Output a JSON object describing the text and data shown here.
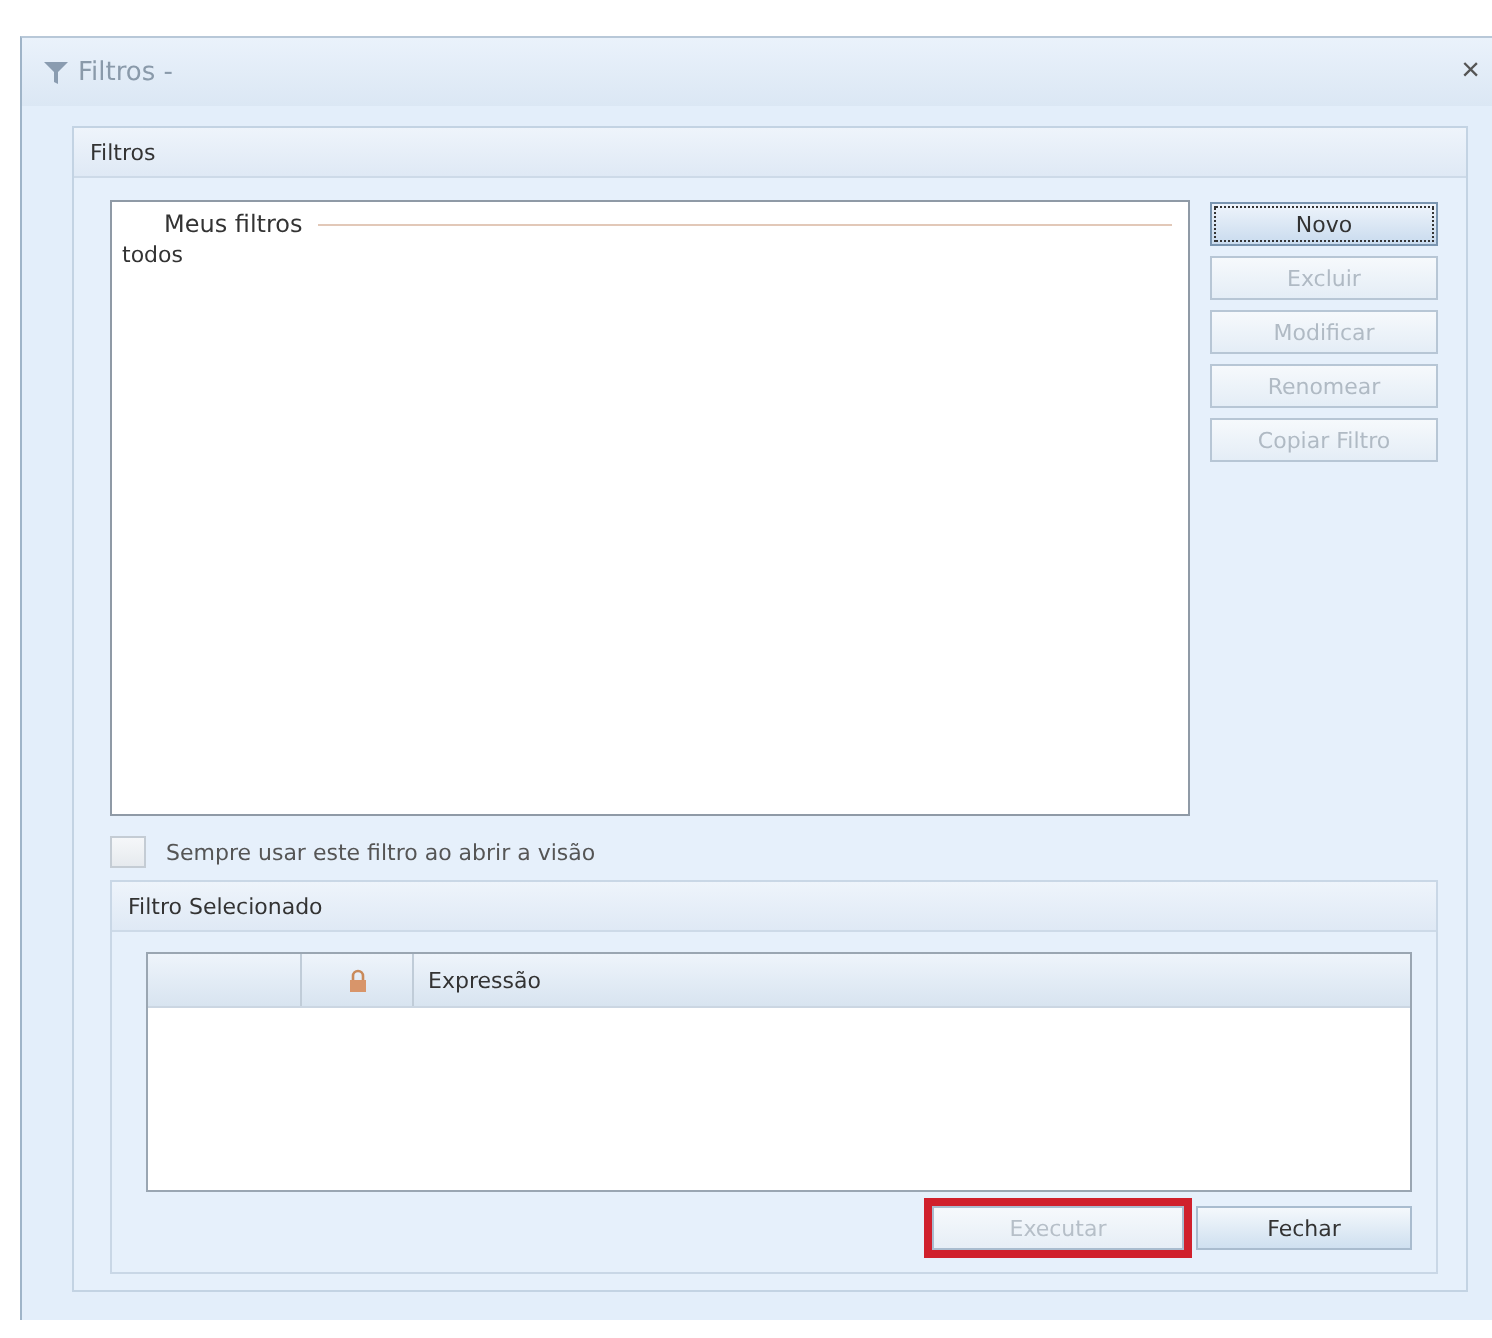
{
  "window": {
    "title": "Filtros -",
    "close": "×"
  },
  "panel": {
    "title": "Filtros"
  },
  "filters_list": {
    "legend": "Meus filtros",
    "items": [
      {
        "label": "todos",
        "selected": false
      }
    ]
  },
  "side_buttons": [
    {
      "label": "Novo",
      "disabled": false,
      "focused": true
    },
    {
      "label": "Excluir",
      "disabled": true,
      "focused": false
    },
    {
      "label": "Modificar",
      "disabled": true,
      "focused": false
    },
    {
      "label": "Renomear",
      "disabled": true,
      "focused": false
    },
    {
      "label": "Copiar Filtro",
      "disabled": true,
      "focused": false
    }
  ],
  "always_use": {
    "label": "Sempre usar este filtro ao abrir a visão",
    "checked": false
  },
  "selected_filter": {
    "title": "Filtro Selecionado",
    "columns": [
      {
        "kind": "blank"
      },
      {
        "kind": "lock"
      },
      {
        "kind": "text",
        "label": "Expressão"
      }
    ]
  },
  "bottom_buttons": [
    {
      "label": "Executar",
      "disabled": true,
      "highlighted": true
    },
    {
      "label": "Fechar",
      "disabled": false,
      "highlighted": false
    }
  ]
}
